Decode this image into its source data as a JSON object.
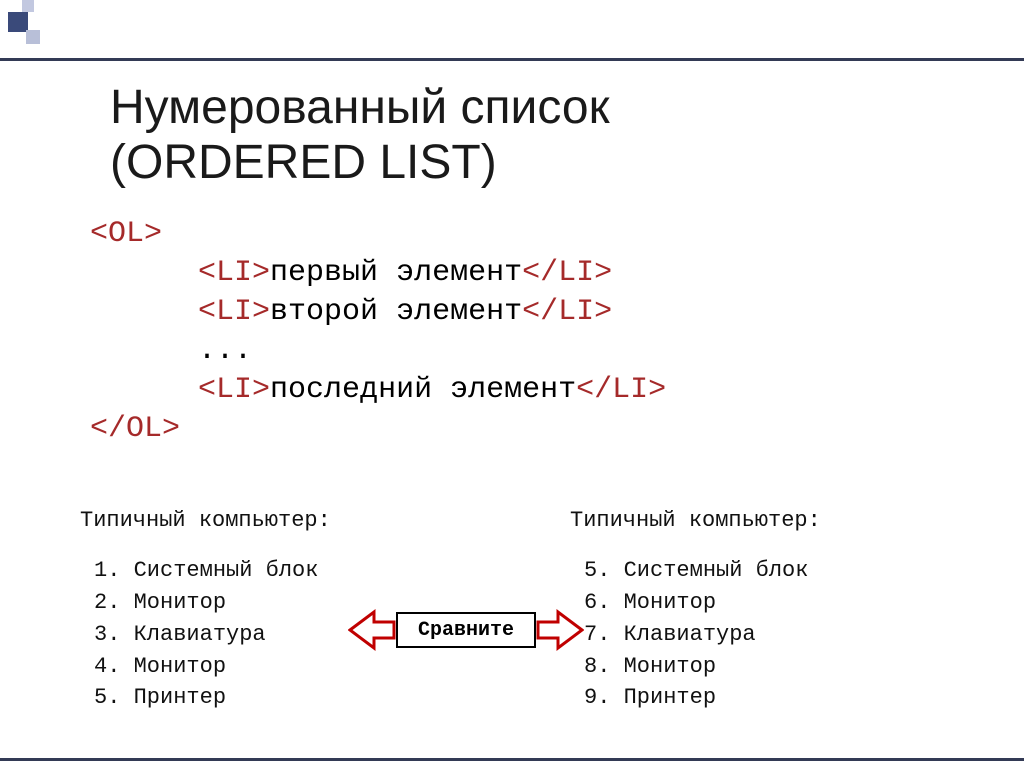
{
  "title_line1": "Нумерованный список",
  "title_line2": "(ORDERED LIST)",
  "code": {
    "ol_open": "<OL>",
    "li_open": "<LI>",
    "li_close": "</LI>",
    "item1": "первый элемент",
    "item2": "второй элемент",
    "dots": "...",
    "item_last": "последний элемент",
    "ol_close": "</OL>"
  },
  "example_left": {
    "heading": "Типичный компьютер:",
    "items": [
      "1. Системный блок",
      "2. Монитор",
      "3. Клавиатура",
      "4. Монитор",
      "5. Принтер"
    ]
  },
  "example_right": {
    "heading": "Типичный компьютер:",
    "items": [
      "5. Системный блок",
      "6. Монитор",
      "7. Клавиатура",
      "8. Монитор",
      "9. Принтер"
    ]
  },
  "compare_label": "Сравните"
}
